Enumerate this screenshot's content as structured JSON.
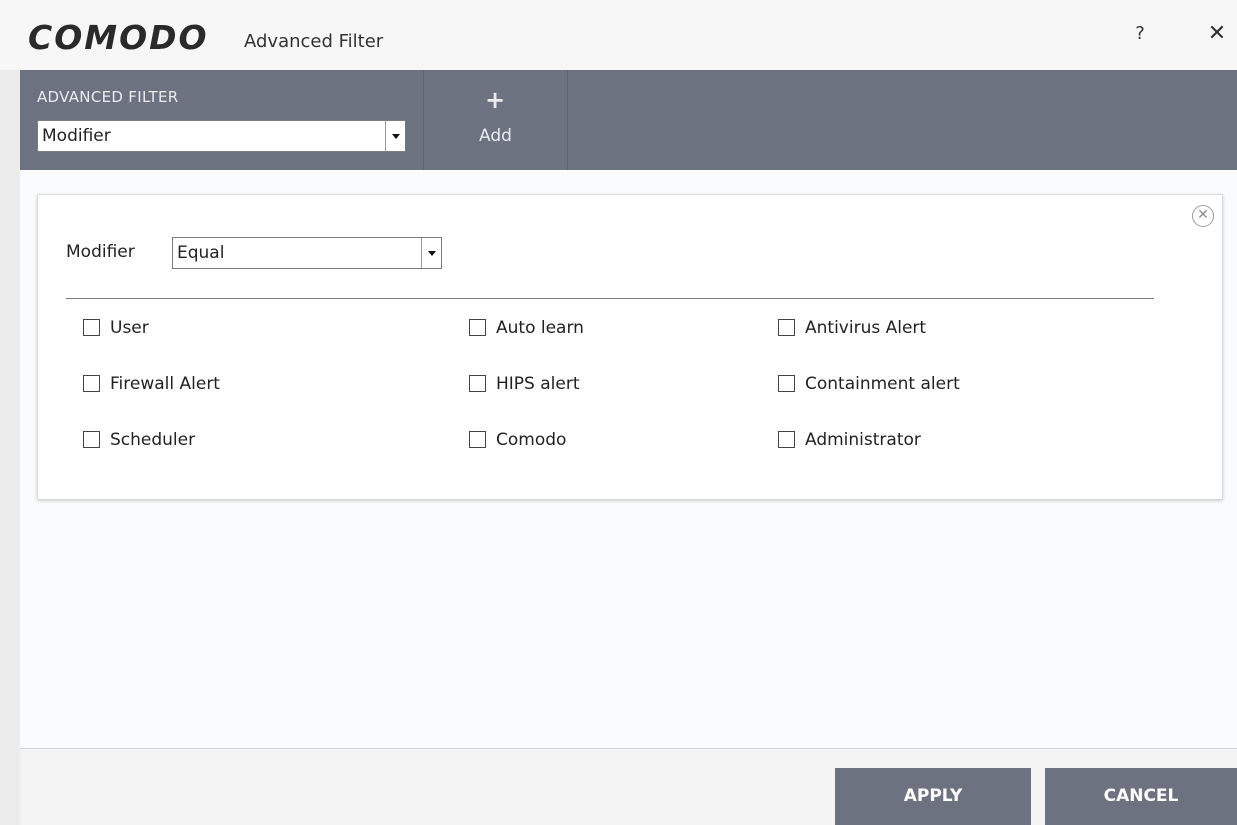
{
  "window": {
    "logo": "COMODO",
    "title": "Advanced Filter",
    "help_label": "?",
    "close_label": "✕"
  },
  "toolbar": {
    "filter_heading": "ADVANCED FILTER",
    "filter_select_value": "Modifier",
    "add_icon": "+",
    "add_label": "Add"
  },
  "filter_card": {
    "close_label": "✕",
    "modifier_label": "Modifier",
    "modifier_select_value": "Equal",
    "checkboxes": [
      {
        "label": "User",
        "checked": false
      },
      {
        "label": "Auto learn",
        "checked": false
      },
      {
        "label": "Antivirus Alert",
        "checked": false
      },
      {
        "label": "Firewall Alert",
        "checked": false
      },
      {
        "label": "HIPS alert",
        "checked": false
      },
      {
        "label": "Containment alert",
        "checked": false
      },
      {
        "label": "Scheduler",
        "checked": false
      },
      {
        "label": "Comodo",
        "checked": false
      },
      {
        "label": "Administrator",
        "checked": false
      }
    ]
  },
  "footer": {
    "apply_label": "APPLY",
    "cancel_label": "CANCEL"
  }
}
